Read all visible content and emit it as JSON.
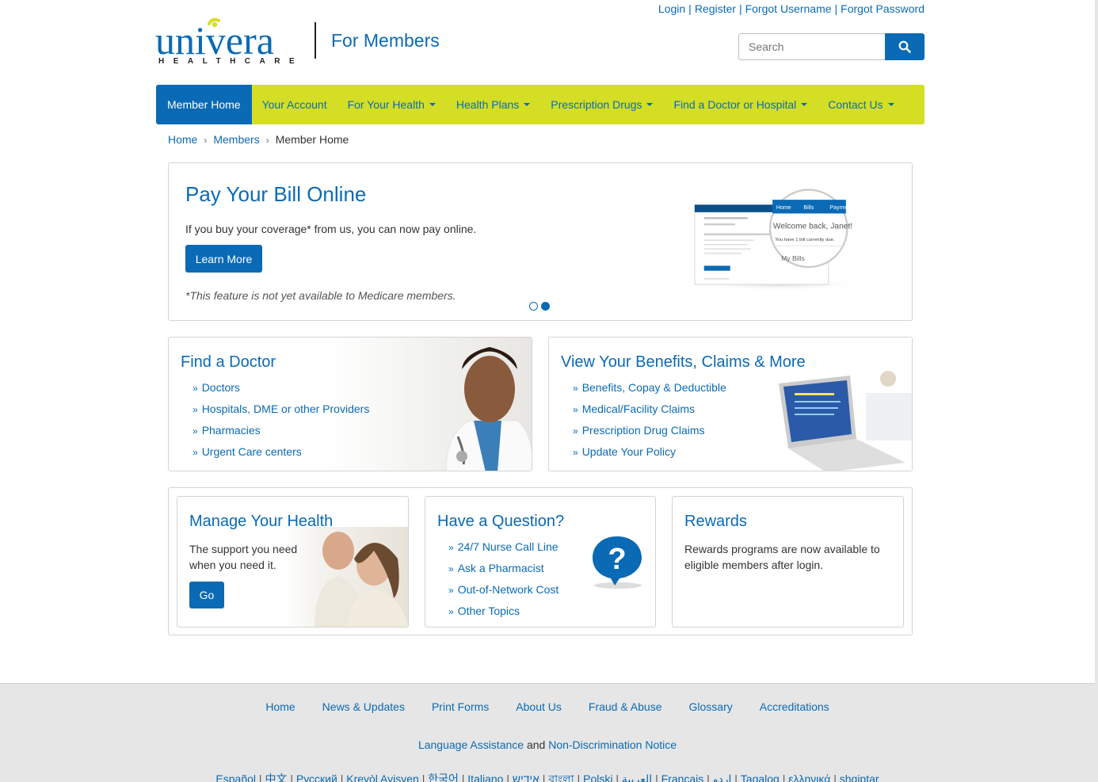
{
  "top_links": [
    "Login",
    "Register",
    "Forgot Username",
    "Forgot Password"
  ],
  "brand": {
    "logo_text": "univera",
    "logo_sub": "HEALTHCARE",
    "site_title": "For Members"
  },
  "search": {
    "placeholder": "Search",
    "icon": "search-icon"
  },
  "nav": {
    "items": [
      {
        "label": "Member Home",
        "active": true,
        "dropdown": false
      },
      {
        "label": "Your Account",
        "dropdown": false
      },
      {
        "label": "For Your Health",
        "dropdown": true
      },
      {
        "label": "Health Plans",
        "dropdown": true
      },
      {
        "label": "Prescription Drugs",
        "dropdown": true
      },
      {
        "label": "Find a Doctor or Hospital",
        "dropdown": true
      },
      {
        "label": "Contact Us",
        "dropdown": true
      }
    ],
    "bar_color": "#d4de25",
    "active_color": "#0a6ab5"
  },
  "breadcrumb": [
    "Home",
    "Members",
    "Member Home"
  ],
  "hero": {
    "title": "Pay Your Bill Online",
    "description": "If you buy your coverage* from us, you can now pay online.",
    "button": "Learn More",
    "note": "*This feature is not yet available to Medicare members.",
    "slides_total": 2,
    "slide_active": 2,
    "art": {
      "tabs": [
        "Home",
        "Bills",
        "Payme"
      ],
      "greeting": "Welcome back, Janet!",
      "bill_line": "You have 1 bill currently due.",
      "section": "My Bills"
    }
  },
  "find_doctor": {
    "title": "Find a Doctor",
    "links": [
      "Doctors",
      "Hospitals, DME or other Providers",
      "Pharmacies",
      "Urgent Care centers"
    ]
  },
  "benefits": {
    "title": "View Your Benefits, Claims & More",
    "links": [
      "Benefits, Copay & Deductible",
      "Medical/Facility Claims",
      "Prescription Drug Claims",
      "Update Your Policy"
    ]
  },
  "manage_health": {
    "title": "Manage Your Health",
    "line1": "The support you need",
    "line2": "when you need it.",
    "button": "Go"
  },
  "question": {
    "title": "Have a Question?",
    "links": [
      "24/7 Nurse Call Line",
      "Ask a Pharmacist",
      "Out-of-Network Cost",
      "Other Topics"
    ],
    "icon_glyph": "?"
  },
  "rewards": {
    "title": "Rewards",
    "line1": "Rewards programs are now available to",
    "line2": "eligible members after login."
  },
  "footer": {
    "links": [
      "Home",
      "News & Updates",
      "Print Forms",
      "About Us",
      "Fraud & Abuse",
      "Glossary",
      "Accreditations"
    ],
    "notice": {
      "link1": "Language Assistance",
      "and": "and",
      "link2": "Non-Discrimination Notice"
    },
    "languages": [
      "Español",
      "中文",
      "Русский",
      "Kreyòl Ayisyen",
      "한국어",
      "Italiano",
      "אידיש",
      "বাংলা",
      "Polski",
      "العربية",
      "Français",
      "اردو",
      "Tagalog",
      "ελληνικά",
      "shqiptar"
    ]
  }
}
